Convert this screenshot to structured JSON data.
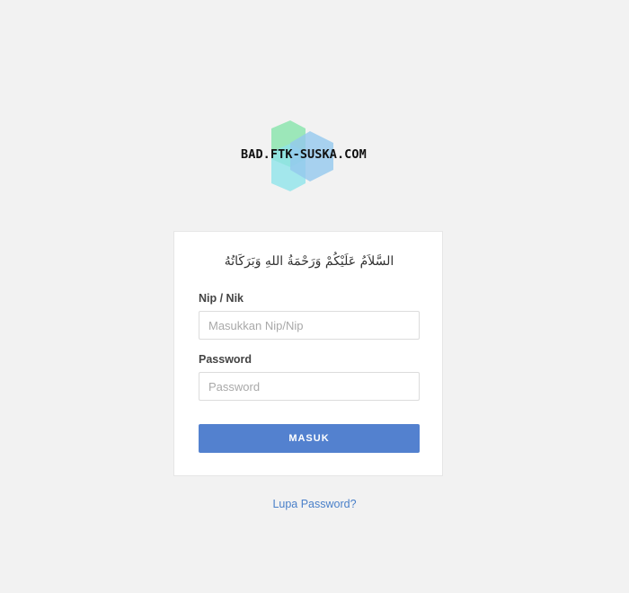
{
  "brand": {
    "logo_text": "BAD.FTK-SUSKA.COM"
  },
  "login": {
    "greeting": "السَّلاَمُ عَلَيْكُمْ وَرَحْمَةُ اللهِ وَبَرَكَاتُهُ",
    "nip_label": "Nip / Nik",
    "nip_placeholder": "Masukkan Nip/Nip",
    "nip_value": "",
    "password_label": "Password",
    "password_placeholder": "Password",
    "password_value": "",
    "submit_label": "MASUK"
  },
  "links": {
    "forgot_password": "Lupa Password?"
  },
  "colors": {
    "background": "#f2f2f2",
    "button": "#5381cf",
    "link": "#4a80c9",
    "logo_green": "#7fe3a6",
    "logo_cyan": "#8fe4ea",
    "logo_blue": "#93c8ee"
  }
}
